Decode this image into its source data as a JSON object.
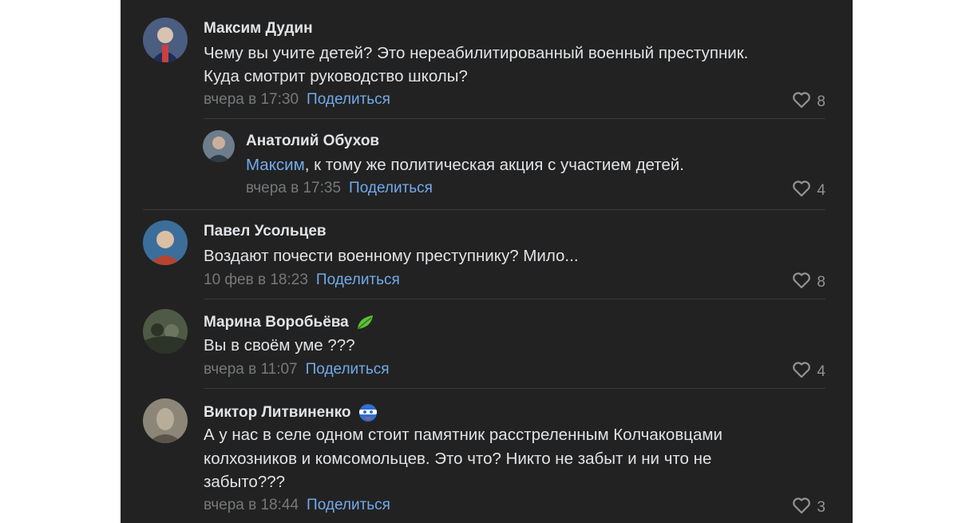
{
  "comments": [
    {
      "author": "Максим Дудин",
      "lines": [
        "Чему вы учите детей? Это нереабилитированный военный преступник.",
        "Куда смотрит руководство школы?"
      ],
      "time": "вчера в 17:30",
      "share": "Поделиться",
      "likes": "8",
      "avatar_colors": [
        "#5a6b8c",
        "#2e3b66",
        "#d9d2cc"
      ]
    },
    {
      "author": "Анатолий Обухов",
      "mention": "Максим",
      "rest": ", к тому же политическая акция с участием детей.",
      "time": "вчера в 17:35",
      "share": "Поделиться",
      "likes": "4",
      "avatar_colors": [
        "#7a8a99",
        "#3c4650",
        "#c9b9a6"
      ]
    },
    {
      "author": "Павел Усольцев",
      "lines": [
        "Воздают почести военному преступнику? Мило..."
      ],
      "time": "10 фев в 18:23",
      "share": "Поделиться",
      "likes": "8",
      "avatar_colors": [
        "#3c6e9c",
        "#b5442e",
        "#e0c4a8"
      ]
    },
    {
      "author": "Марина Воробьёва",
      "badge": "leaf-badge-icon",
      "lines": [
        "Вы в своём уме ???"
      ],
      "time": "вчера в 11:07",
      "share": "Поделиться",
      "likes": "4",
      "avatar_colors": [
        "#5b6650",
        "#2c3328",
        "#8a8f78"
      ]
    },
    {
      "author": "Виктор Литвиненко",
      "badge": "hero-mask-badge-icon",
      "lines": [
        "А у нас в селе одном стоит памятник расстреленным Колчаковцами",
        "колхозников и комсомольцев. Это что? Никто не забыт и ни что не",
        "забыто???"
      ],
      "time": "вчера в 18:44",
      "share": "Поделиться",
      "likes": "3",
      "avatar_colors": [
        "#8c8678",
        "#5a544a",
        "#b8ad98"
      ]
    }
  ],
  "colors": {
    "panel": "#222222",
    "link": "#71aaeb",
    "text": "#e1e3e6",
    "muted": "#76787a"
  },
  "icons": {
    "like": "heart-outline-icon"
  }
}
